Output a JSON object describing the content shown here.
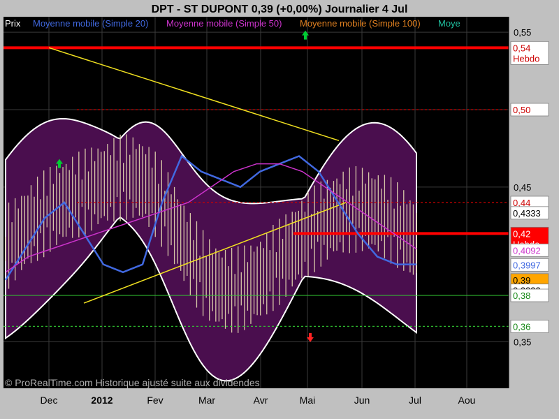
{
  "chart_data": {
    "type": "line",
    "title": "DPT - ST DUPONT     0,39 (+0,00%)     Journalier  4 Jul",
    "legend": {
      "prix": "Prix",
      "items": [
        {
          "name": "Moyenne mobile (Simple 20)",
          "color": "#4169e1"
        },
        {
          "name": "Moyenne mobile (Simple 50)",
          "color": "#cc33cc"
        },
        {
          "name": "Moyenne mobile (Simple 100)",
          "color": "#e08020"
        },
        {
          "name": "Moye",
          "color": "#20c0a0"
        }
      ]
    },
    "x_ticks": [
      "Dec",
      "2012",
      "Fev",
      "Mar",
      "Avr",
      "Mai",
      "Jun",
      "Jul",
      "Aou"
    ],
    "y_ticks": [
      "0,55",
      "0,50",
      "0,45",
      "0,35"
    ],
    "ylim": [
      0.32,
      0.56
    ],
    "price_tags": [
      {
        "value": 0.54,
        "lines": [
          "0,54",
          "Hebdo"
        ],
        "bg": "#ffffff",
        "fg": "#cc0000"
      },
      {
        "value": 0.5,
        "lines": [
          "0,50"
        ],
        "bg": "#ffffff",
        "fg": "#cc0000"
      },
      {
        "value": 0.44,
        "lines": [
          "0,44"
        ],
        "bg": "#ffffff",
        "fg": "#cc0000"
      },
      {
        "value": 0.4333,
        "lines": [
          "0,4333"
        ],
        "bg": "#ffffff",
        "fg": "#000000"
      },
      {
        "value": 0.42,
        "lines": [
          "0,42",
          "Hebdo"
        ],
        "bg": "#ff0000",
        "fg": "#ffffff"
      },
      {
        "value": 0.4092,
        "lines": [
          "0,4092"
        ],
        "bg": "#ffffff",
        "fg": "#cc33cc"
      },
      {
        "value": 0.3997,
        "lines": [
          "0,3997"
        ],
        "bg": "#ffffff",
        "fg": "#4169e1"
      },
      {
        "value": 0.39,
        "lines": [
          "0,39"
        ],
        "bg": "#ffa500",
        "fg": "#000000"
      },
      {
        "value": 0.3833,
        "lines": [
          "0,3833"
        ],
        "bg": "#ffffff",
        "fg": "#000000"
      },
      {
        "value": 0.38,
        "lines": [
          "0,38"
        ],
        "bg": "#ffffff",
        "fg": "#1a8a1a"
      },
      {
        "value": 0.36,
        "lines": [
          "0,36"
        ],
        "bg": "#ffffff",
        "fg": "#1a8a1a"
      }
    ],
    "horizontal_levels": [
      {
        "value": 0.54,
        "color": "#ff0000",
        "style": "thick"
      },
      {
        "value": 0.5,
        "color": "#cc0000",
        "style": "dotted"
      },
      {
        "value": 0.44,
        "color": "#cc0000",
        "style": "dotted"
      },
      {
        "value": 0.42,
        "color": "#ff0000",
        "style": "thick"
      },
      {
        "value": 0.38,
        "color": "#33cc33",
        "style": "thin"
      },
      {
        "value": 0.36,
        "color": "#33cc33",
        "style": "dotted"
      }
    ],
    "trendlines": [
      {
        "from": [
          "Dec",
          0.54
        ],
        "to": [
          "Mai",
          0.48
        ],
        "color": "#f0e020"
      },
      {
        "from": [
          "Dec",
          0.375
        ],
        "to": [
          "Mai",
          0.44
        ],
        "color": "#f0e020"
      }
    ],
    "series_points": {
      "Moyenne mobile (Simple 20)": [
        [
          0.39
        ],
        [
          0.41
        ],
        [
          0.43
        ],
        [
          0.44
        ],
        [
          0.42
        ],
        [
          0.4
        ],
        [
          0.395
        ],
        [
          0.4
        ],
        [
          0.44
        ],
        [
          0.47
        ],
        [
          0.46
        ],
        [
          0.455
        ],
        [
          0.45
        ],
        [
          0.46
        ],
        [
          0.465
        ],
        [
          0.47
        ],
        [
          0.46
        ],
        [
          0.44
        ],
        [
          0.42
        ],
        [
          0.405
        ],
        [
          0.4
        ],
        [
          0.4
        ]
      ],
      "Moyenne mobile (Simple 50)": [
        [
          0.395
        ],
        [
          0.405
        ],
        [
          0.41
        ],
        [
          0.415
        ],
        [
          0.42
        ],
        [
          0.425
        ],
        [
          0.43
        ],
        [
          0.435
        ],
        [
          0.44
        ],
        [
          0.45
        ],
        [
          0.46
        ],
        [
          0.465
        ],
        [
          0.465
        ],
        [
          0.46
        ],
        [
          0.45
        ],
        [
          0.44
        ],
        [
          0.43
        ],
        [
          0.42
        ],
        [
          0.41
        ]
      ]
    },
    "watermark": "© ProRealTime.com Historique ajusté suite aux dividendes",
    "colors": {
      "background": "#000000",
      "panel": "#c0c0c0",
      "bollinger_fill": "#4a0e4e",
      "bollinger_edge": "#ffffff",
      "bars": "#d8c8a8",
      "arrow_up": "#00cc33",
      "arrow_down": "#ff2222"
    }
  }
}
